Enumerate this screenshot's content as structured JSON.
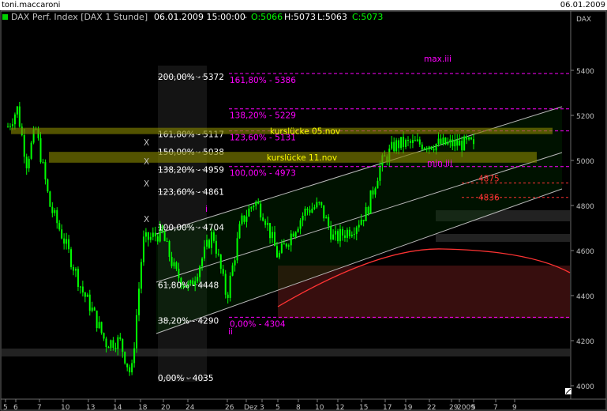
{
  "window": {
    "user": "toni.maccaroni",
    "date": "06.01.2009"
  },
  "header": {
    "instrument": "DAX Perf. Index [DAX  1 Stunde]",
    "datetime": "06.01.2009 15:00:00",
    "ohlc_sep": "-",
    "open": "O:5066",
    "high": "H:5073",
    "low": "L:5063",
    "close": "C:5073"
  },
  "colors": {
    "background": "#000000",
    "candles": "#00ff00",
    "fib": "#ffffff",
    "targets": "#ff00ff",
    "gaps": "#808000",
    "gap_text": "#ffff00",
    "resistance": "#ff3333"
  },
  "chart_data": {
    "type": "candlestick",
    "y_axis": {
      "min": 4000,
      "max": 5500,
      "ticks": [
        4000,
        4200,
        4400,
        4600,
        4800,
        5000,
        5200,
        5400
      ],
      "side": "right",
      "badge": "DAX"
    },
    "x_axis_labels": [
      "5",
      "6",
      "7",
      "10",
      "13",
      "14",
      "18",
      "20",
      "24",
      "26",
      "Dez",
      "3",
      "5",
      "8",
      "10",
      "12",
      "15",
      "17",
      "19",
      "22",
      "29",
      "2009",
      "5",
      "7",
      "9"
    ],
    "candles_summary": {
      "first_close": 5150,
      "low": 4035,
      "high": 5230,
      "last_close": 5073,
      "path": [
        [
          0.0,
          5150
        ],
        [
          0.02,
          5230
        ],
        [
          0.04,
          4990
        ],
        [
          0.06,
          5140
        ],
        [
          0.09,
          4800
        ],
        [
          0.12,
          4650
        ],
        [
          0.16,
          4420
        ],
        [
          0.18,
          4340
        ],
        [
          0.21,
          4190
        ],
        [
          0.24,
          4200
        ],
        [
          0.265,
          4040
        ],
        [
          0.29,
          4640
        ],
        [
          0.33,
          4680
        ],
        [
          0.36,
          4500
        ],
        [
          0.39,
          4430
        ],
        [
          0.44,
          4680
        ],
        [
          0.47,
          4390
        ],
        [
          0.5,
          4720
        ],
        [
          0.53,
          4820
        ],
        [
          0.55,
          4760
        ],
        [
          0.58,
          4570
        ],
        [
          0.61,
          4680
        ],
        [
          0.64,
          4780
        ],
        [
          0.67,
          4800
        ],
        [
          0.7,
          4650
        ],
        [
          0.74,
          4700
        ],
        [
          0.77,
          4770
        ],
        [
          0.8,
          4980
        ],
        [
          0.83,
          5066
        ],
        [
          0.84,
          5073
        ]
      ]
    },
    "fib_retracement": [
      {
        "label": "200,00% - 5372",
        "value": 5372
      },
      {
        "label": "161,80% - 5117",
        "value": 5117
      },
      {
        "label": "150,00% - 5038",
        "value": 5038
      },
      {
        "label": "138,20% - 4959",
        "value": 4959
      },
      {
        "label": "123,60% - 4861",
        "value": 4861
      },
      {
        "label": "100,00% - 4704",
        "value": 4704
      },
      {
        "label": "61,80% - 4448",
        "value": 4448
      },
      {
        "label": "38,20% - 4290",
        "value": 4290
      },
      {
        "label": "0,00% - 4035",
        "value": 4035
      }
    ],
    "fib_targets": [
      {
        "label": "161,80% - 5386",
        "value": 5386
      },
      {
        "label": "138,20% - 5229",
        "value": 5229
      },
      {
        "label": "123,60% - 5131",
        "value": 5131
      },
      {
        "label": "100,00% - 4973",
        "value": 4973
      },
      {
        "label": "0,00% - 4304",
        "value": 4304
      }
    ],
    "gaps": [
      {
        "label": "kurslücke 05.nov",
        "low": 5117,
        "high": 5145
      },
      {
        "label": "kurslücke 11.nov",
        "low": 4990,
        "high": 5038
      }
    ],
    "levels": [
      {
        "label": "4875",
        "value": 4900
      },
      {
        "label": "4836",
        "value": 4836
      }
    ],
    "annotations": {
      "max": "max.iii",
      "min": "min.iii",
      "wave_i": "i",
      "wave_ii": "ii",
      "marker": "X"
    }
  }
}
